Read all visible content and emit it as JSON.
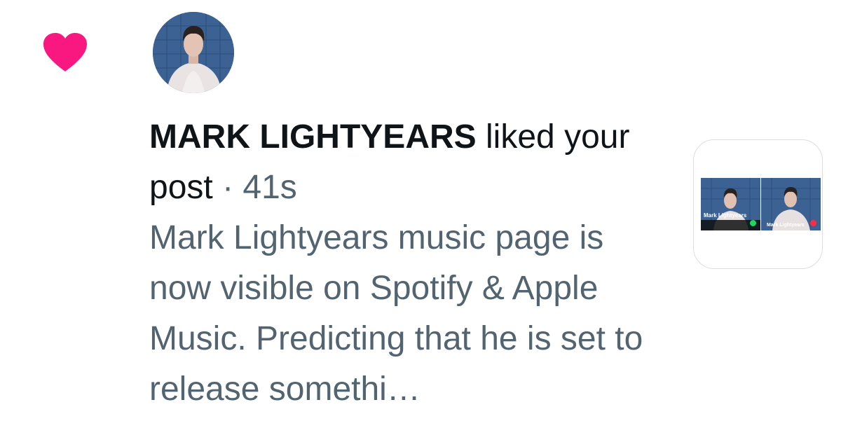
{
  "notification": {
    "icon": "heart-icon",
    "icon_color": "#f91880",
    "username": "MARK LIGHTYEARS",
    "action": " liked your post",
    "separator": " · ",
    "time": "41s",
    "snippet": "Mark Lightyears music page is now visible on Spotify & Apple Music. Predicting that he is set to release somethi…"
  },
  "preview": {
    "thumbs": [
      {
        "label": "Mark Lightyears",
        "accent": "#1ed760"
      },
      {
        "label": "Mark Lightyears",
        "accent": "#fa2d48"
      }
    ]
  },
  "colors": {
    "primary_text": "#0f1419",
    "secondary_text": "#536471",
    "card_border": "#d9dee3"
  }
}
